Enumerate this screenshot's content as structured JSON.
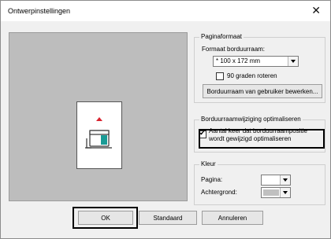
{
  "window": {
    "title": "Ontwerpinstellingen"
  },
  "paper_size": {
    "group_title": "Paginaformaat",
    "hoop_label": "Formaat borduurraam:",
    "hoop_value": "* 100 x 172 mm",
    "rotate_label": "90 graden roteren",
    "rotate_checked": false,
    "edit_button": "Borduurraam van gebruiker bewerken..."
  },
  "optimize": {
    "group_title": "Borduurraamwijziging optimaliseren",
    "line1": "Aantal keer dat borduurraampositie",
    "line2": "wordt gewijzigd optimaliseren",
    "checked": true
  },
  "color": {
    "group_title": "Kleur",
    "page_label": "Pagina:",
    "page_swatch": "#ffffff",
    "background_label": "Achtergrond:",
    "background_swatch": "#c0c0c0"
  },
  "buttons": {
    "ok": "OK",
    "default": "Standaard",
    "cancel": "Annuleren"
  }
}
